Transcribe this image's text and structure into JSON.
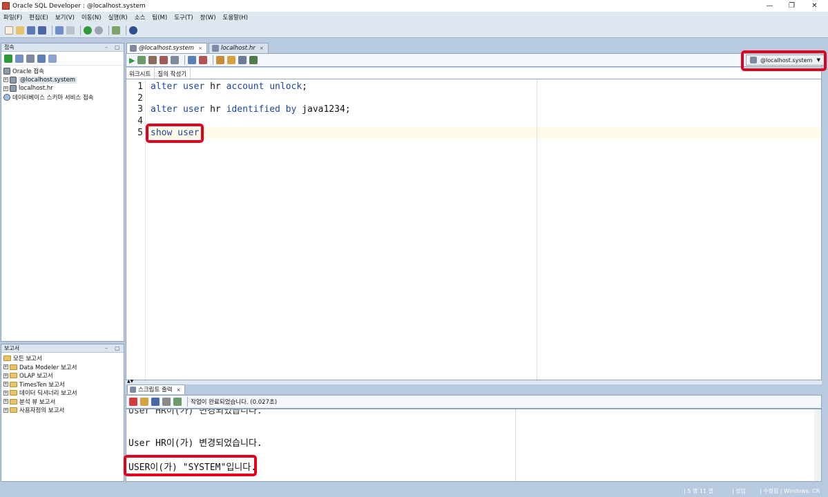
{
  "window": {
    "title": "Oracle SQL Developer : @localhost.system",
    "minimize": "—",
    "maximize": "❐",
    "close": "✕"
  },
  "menu": [
    "파일(F)",
    "편집(E)",
    "보기(V)",
    "이동(N)",
    "실행(R)",
    "소스",
    "팀(M)",
    "도구(T)",
    "창(W)",
    "도움말(H)"
  ],
  "connections_panel": {
    "title": "접속",
    "root": "Oracle 접속",
    "items": [
      "@localhost.system",
      "localhost.hr"
    ],
    "schema_service": "데이터베이스 스키마 서비스 접속"
  },
  "reports_panel": {
    "title": "보고서",
    "root": "모든 보고서",
    "items": [
      "Data Modeler 보고서",
      "OLAP 보고서",
      "TimesTen 보고서",
      "데이터 딕셔너리 보고서",
      "분석 뷰 보고서",
      "사용자정의 보고서"
    ]
  },
  "editor": {
    "tabs": [
      {
        "label": "@localhost.system",
        "active": true
      },
      {
        "label": "localhost.hr",
        "active": false
      }
    ],
    "connection": "@localhost.system",
    "subtabs": [
      "워크시트",
      "질의 작성기"
    ],
    "line_numbers": [
      "1",
      "2",
      "3",
      "4",
      "5"
    ],
    "lines": [
      {
        "kw": "alter user",
        "rest": " hr ",
        "kw2": "account unlock",
        "end": ";"
      },
      {
        "kw": "",
        "rest": "",
        "kw2": "",
        "end": ""
      },
      {
        "kw": "alter user",
        "rest": " hr ",
        "kw2": "identified by",
        "end": " java1234;"
      },
      {
        "kw": "",
        "rest": "",
        "kw2": "",
        "end": ""
      },
      {
        "kw": "show user",
        "rest": "",
        "kw2": "",
        "end": ";"
      }
    ]
  },
  "output": {
    "tab": "스크립트 출력",
    "status": "작업이 완료되었습니다. (0.027초)",
    "lines": [
      "User HR이(가) 변경되었습니다.",
      "USER이(가) \"SYSTEM\"입니다."
    ],
    "cut_line": "User HR이(가) 변경되었습니다."
  },
  "statusbar": {
    "position": "| 5 행 11 열",
    "mode": "| 삽입",
    "modified": "| 수정됨 | Windows: CR"
  },
  "colors": {
    "highlight": "#e3001b",
    "keyword": "#1b45a0"
  }
}
